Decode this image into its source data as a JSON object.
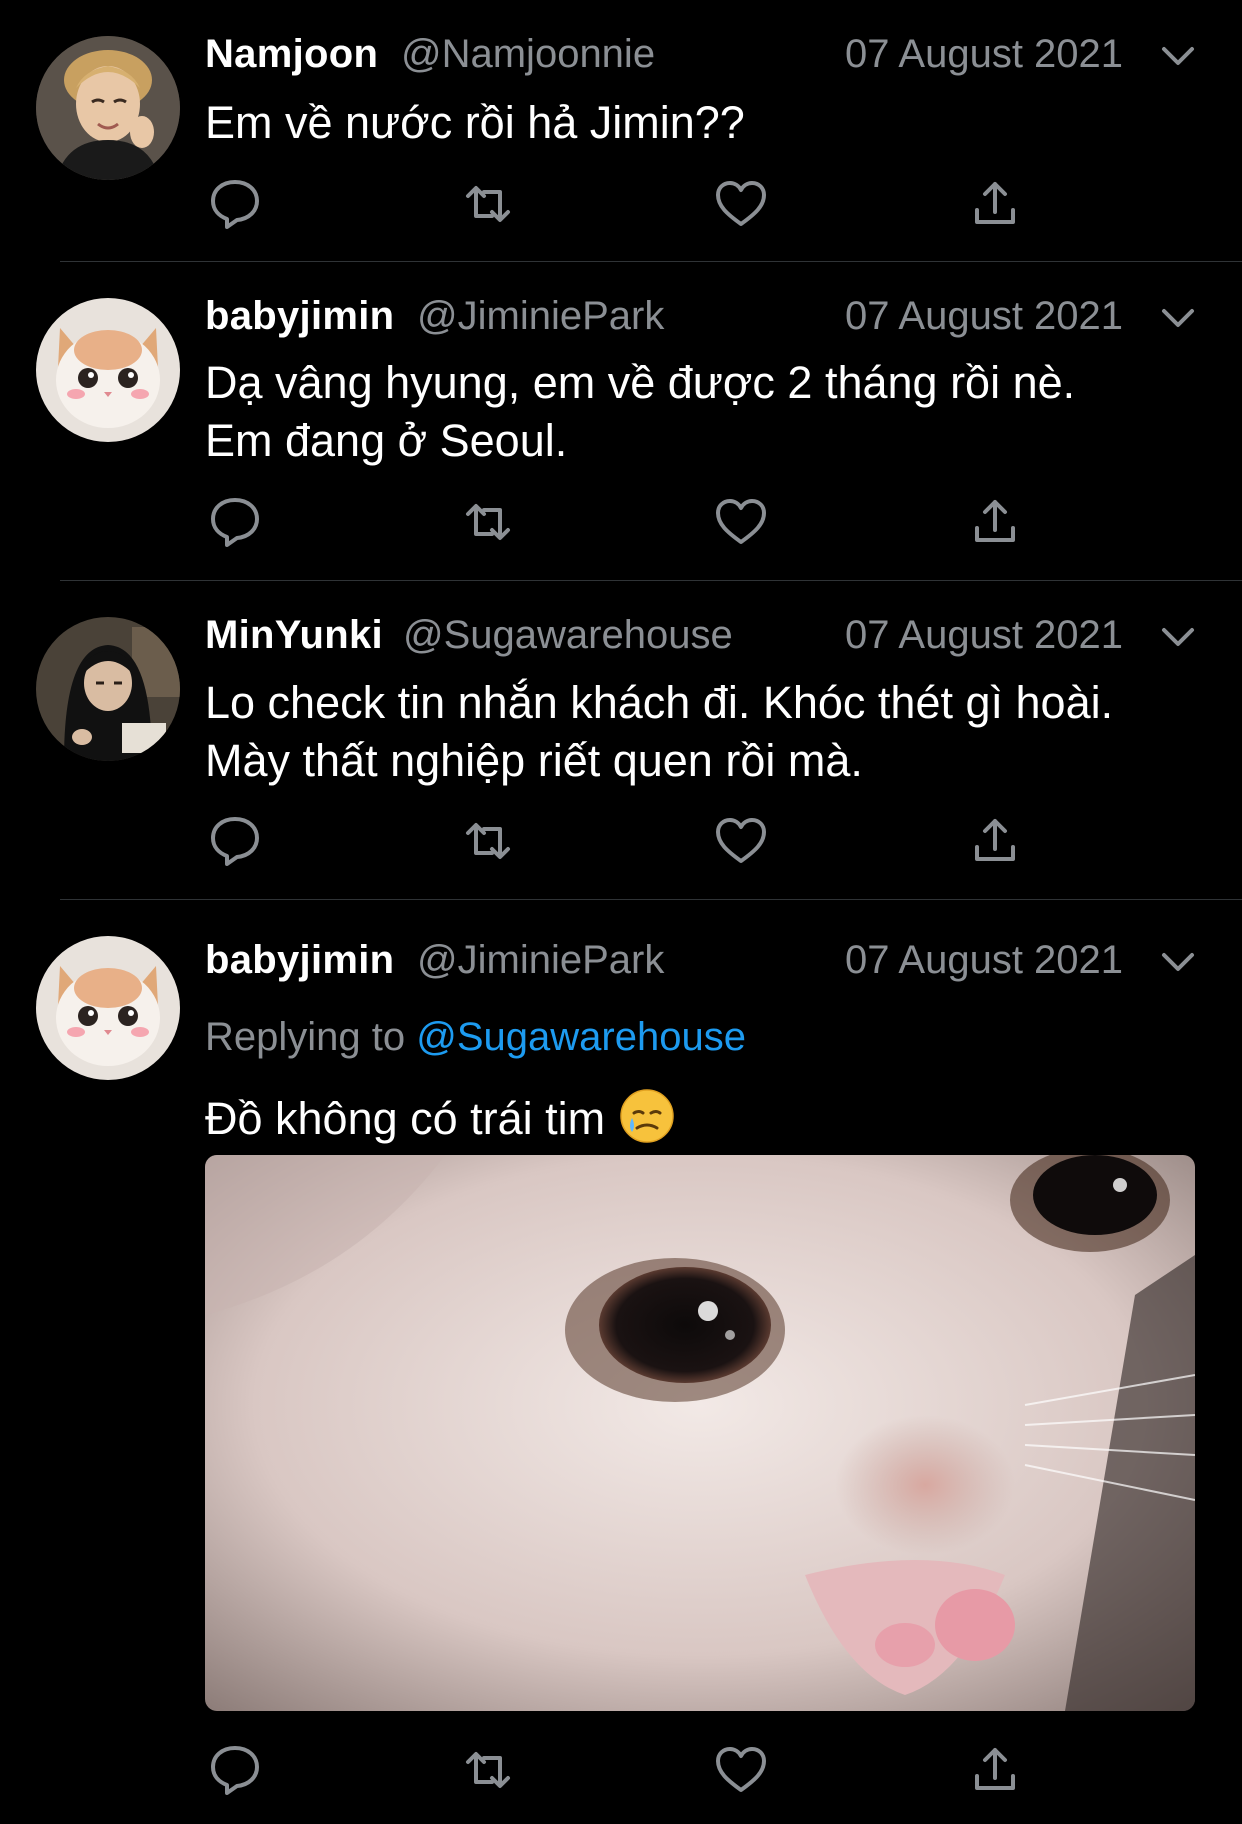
{
  "colors": {
    "background": "#000000",
    "text_primary": "#ffffff",
    "text_secondary": "#8b8f94",
    "link": "#1d9bf0",
    "divider": "#2f3336",
    "icon": "#8b8f94"
  },
  "tweets": [
    {
      "display_name": "Namjoon",
      "handle": "@Namjoonnie",
      "date": "07 August 2021",
      "avatar": "person-avatar",
      "lines": [
        "Em về nước rồi hả Jimin??"
      ]
    },
    {
      "display_name": "babyjimin",
      "handle": "@JiminiePark",
      "date": "07 August 2021",
      "avatar": "cat-avatar",
      "lines": [
        "Dạ vâng hyung, em về được 2 tháng rồi nè.",
        "Em đang ở Seoul."
      ]
    },
    {
      "display_name": "MinYunki",
      "handle": "@Sugawarehouse",
      "date": "07 August 2021",
      "avatar": "person-hood-avatar",
      "lines": [
        "Lo check tin nhắn khách đi. Khóc thét gì hoài.",
        "Mày thất nghiệp riết quen rồi mà."
      ]
    },
    {
      "display_name": "babyjimin",
      "handle": "@JiminiePark",
      "date": "07 August 2021",
      "avatar": "cat-avatar",
      "replying_prefix": "Replying to",
      "replying_handle": "@Sugawarehouse",
      "lines": [
        "Đồ không có trái tim"
      ],
      "emoji": "crying-face-emoji",
      "media": "crying-cat-image"
    }
  ],
  "action_icons": [
    "reply-icon",
    "retweet-icon",
    "like-icon",
    "share-icon"
  ]
}
